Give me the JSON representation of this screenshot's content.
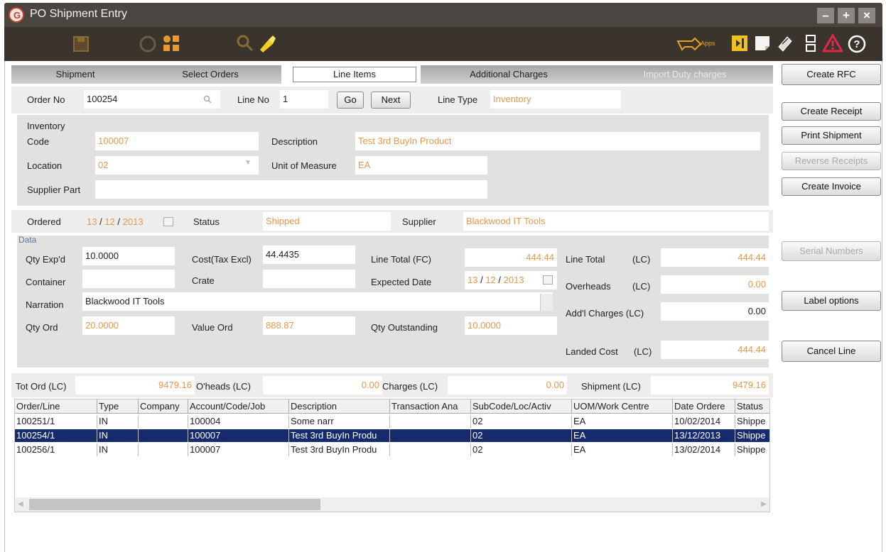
{
  "window": {
    "title": "PO Shipment Entry",
    "logo_letter": "G",
    "apps_label": "Apps"
  },
  "colors": {
    "titlebar": "#4a4540",
    "toolbar": "#3a342c",
    "accent_orange": "#e8974e",
    "selection": "#162a6e"
  },
  "toolbar_icons": [
    "save-icon",
    "refresh-icon",
    "grid-icon",
    "search-icon",
    "flashlight-icon",
    "key-icon",
    "export-icon",
    "note-icon",
    "attach-icon",
    "layout-icon",
    "warning-icon",
    "help-icon"
  ],
  "tabs": [
    {
      "label": "Shipment"
    },
    {
      "label": "Select Orders"
    },
    {
      "label": "Line Items"
    },
    {
      "label": "Additional Charges"
    },
    {
      "label": "Import Duty charges"
    }
  ],
  "line": {
    "order_no_label": "Order No",
    "order_no": "100254",
    "line_no_label": "Line No",
    "line_no": "1",
    "go_label": "Go",
    "next_label": "Next",
    "line_type_label": "Line Type",
    "line_type": "Inventory"
  },
  "inventory": {
    "group_label": "Inventory",
    "code_label": "Code",
    "code": "100007",
    "description_label": "Description",
    "description": "Test 3rd BuyIn Product",
    "location_label": "Location",
    "location": "02",
    "uom_label": "Unit of Measure",
    "uom": "EA",
    "supplier_part_label": "Supplier Part",
    "supplier_part": ""
  },
  "status_row": {
    "ordered_label": "Ordered",
    "ordered_day": "13",
    "ordered_month": "12",
    "ordered_year": "2013",
    "status_label": "Status",
    "status": "Shipped",
    "supplier_label": "Supplier",
    "supplier": "Blackwood IT Tools"
  },
  "data": {
    "group_label": "Data",
    "qty_exp_label": "Qty Exp'd",
    "qty_exp": "10.0000",
    "cost_label": "Cost(Tax Excl)",
    "cost": "44.4435",
    "line_total_fc_label": "Line Total (FC)",
    "line_total_fc": "444.44",
    "line_total_lc_label": "Line Total",
    "line_total_lc_unit": "(LC)",
    "line_total_lc": "444.44",
    "container_label": "Container",
    "container": "",
    "crate_label": "Crate",
    "crate": "",
    "expected_date_label": "Expected Date",
    "expected_day": "13",
    "expected_month": "12",
    "expected_year": "2013",
    "overheads_label": "Overheads",
    "overheads_unit": "(LC)",
    "overheads": "0.00",
    "narration_label": "Narration",
    "narration": "Blackwood IT Tools",
    "addl_charges_label": "Add'l Charges (LC)",
    "addl_charges": "0.00",
    "qty_ord_label": "Qty Ord",
    "qty_ord": "20.0000",
    "value_ord_label": "Value Ord",
    "value_ord": "888.87",
    "qty_outstanding_label": "Qty Outstanding",
    "qty_outstanding": "10.0000",
    "landed_cost_label": "Landed Cost",
    "landed_cost_unit": "(LC)",
    "landed_cost": "444.44"
  },
  "totals": {
    "tot_ord_label": "Tot Ord (LC)",
    "tot_ord": "9479.16",
    "oheads_label": "O'heads (LC)",
    "oheads": "0.00",
    "charges_label": "Charges (LC)",
    "charges": "0.00",
    "shipment_label": "Shipment (LC)",
    "shipment": "9479.16"
  },
  "side_buttons": {
    "create_rfc": "Create RFC",
    "create_receipt": "Create Receipt",
    "print_shipment": "Print Shipment",
    "reverse_receipts": "Reverse Receipts",
    "create_invoice": "Create Invoice",
    "serial_numbers": "Serial Numbers",
    "label_options": "Label options",
    "cancel_line": "Cancel Line"
  },
  "grid": {
    "columns": [
      "Order/Line",
      "Type",
      "Company",
      "Account/Code/Job",
      "Description",
      "Transaction Ana",
      "SubCode/Loc/Activ",
      "UOM/Work Centre",
      "Date Ordere",
      "Status"
    ],
    "rows": [
      [
        "100251/1",
        "IN",
        "",
        "100004",
        "Some narr",
        "",
        "02",
        "EA",
        "10/02/2014",
        "Shippe"
      ],
      [
        "100254/1",
        "IN",
        "",
        "100007",
        "Test 3rd BuyIn Produ",
        "",
        "02",
        "EA",
        "13/12/2013",
        "Shippe"
      ],
      [
        "100256/1",
        "IN",
        "",
        "100007",
        "Test 3rd BuyIn Produ",
        "",
        "02",
        "EA",
        "13/02/2014",
        "Shippe"
      ]
    ],
    "selected_row": 1
  }
}
